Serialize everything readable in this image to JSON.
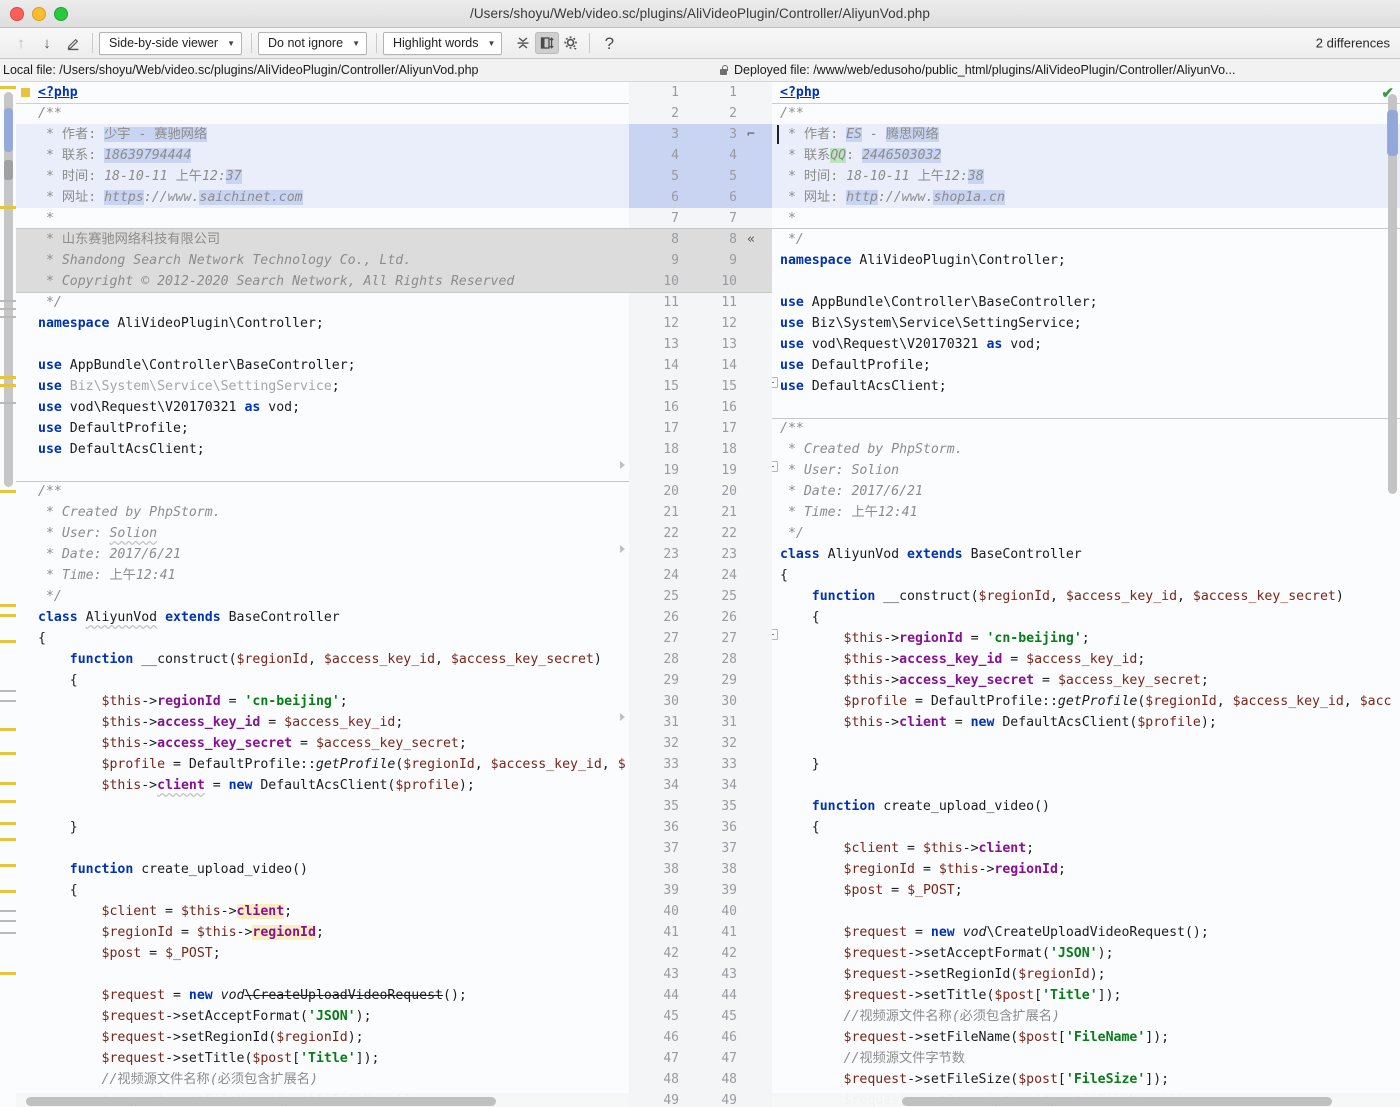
{
  "window": {
    "title": "/Users/shoyu/Web/video.sc/plugins/AliVideoPlugin/Controller/AliyunVod.php",
    "traffic_colors": {
      "close": "#ff5f57",
      "minimize": "#febc2e",
      "zoom": "#28c840"
    }
  },
  "toolbar": {
    "prev_diff_icon": "arrow-up-icon",
    "next_diff_icon": "arrow-down-icon",
    "edit_icon": "pencil-icon",
    "viewer_mode": "Side-by-side viewer",
    "ignore_policy": "Do not ignore",
    "highlight_mode": "Highlight words",
    "collapse_icon": "collapse-unchanged-icon",
    "sync_scroll_icon": "synchronize-scroll-icon",
    "settings_icon": "gear-icon",
    "help_icon": "help-icon",
    "differences_label": "2 differences"
  },
  "paths": {
    "local_label": "Local file: /Users/shoyu/Web/video.sc/plugins/AliVideoPlugin/Controller/AliyunVod.php",
    "deployed_label": "Deployed file: /www/web/edusoho/public_html/plugins/AliVideoPlugin/Controller/AliyunVo...",
    "lock_icon": "lock-icon",
    "ok_icon": "checkmark-icon"
  },
  "left_pane": {
    "lines": [
      "<?php",
      "/**",
      " * 作者: 少宇 - 赛驰网络",
      " * 联系: 18639794444",
      " * 时间: 18-10-11 上午12:37",
      " * 网址: https://www.saichinet.com",
      " *",
      " * 山东赛驰网络科技有限公司",
      " * Shandong Search Network Technology Co., Ltd.",
      " * Copyright © 2012-2020 Search Network, All Rights Reserved",
      " */",
      "namespace AliVideoPlugin\\Controller;",
      "",
      "use AppBundle\\Controller\\BaseController;",
      "use Biz\\System\\Service\\SettingService;",
      "use vod\\Request\\V20170321 as vod;",
      "use DefaultProfile;",
      "use DefaultAcsClient;",
      "",
      "/**",
      " * Created by PhpStorm.",
      " * User: Solion",
      " * Date: 2017/6/21",
      " * Time: 上午12:41",
      " */",
      "class AliyunVod extends BaseController",
      "{",
      "    function __construct($regionId, $access_key_id, $access_key_secret)",
      "    {",
      "        $this->regionId = 'cn-beijing';",
      "        $this->access_key_id = $access_key_id;",
      "        $this->access_key_secret = $access_key_secret;",
      "        $profile = DefaultProfile::getProfile($regionId, $access_key_id, $",
      "        $this->client = new DefaultAcsClient($profile);",
      "",
      "    }",
      "",
      "    function create_upload_video()",
      "    {",
      "        $client = $this->client;",
      "        $regionId = $this->regionId;",
      "        $post = $_POST;",
      "",
      "        $request = new vod\\CreateUploadVideoRequest();",
      "        $request->setAcceptFormat('JSON');",
      "        $request->setRegionId($regionId);",
      "        $request->setTitle($post['Title']);",
      "        //视频源文件名称(必须包含扩展名)"
    ]
  },
  "right_pane": {
    "line_numbers_a": [
      1,
      2,
      3,
      4,
      5,
      6,
      7,
      8,
      9,
      10,
      11,
      12,
      13,
      14,
      15,
      16,
      17,
      18,
      19,
      20,
      21,
      22,
      23,
      24,
      25,
      26,
      27,
      28,
      29,
      30,
      31,
      32,
      33,
      34,
      35,
      36,
      37,
      38,
      39,
      40,
      41,
      42,
      43,
      44,
      45,
      46,
      47,
      48,
      49
    ],
    "line_numbers_b": [
      1,
      2,
      3,
      4,
      5,
      6,
      7,
      8,
      9,
      10,
      11,
      12,
      13,
      14,
      15,
      16,
      17,
      18,
      19,
      20,
      21,
      22,
      23,
      24,
      25,
      26,
      27,
      28,
      29,
      30,
      31,
      32,
      33,
      34,
      35,
      36,
      37,
      38,
      39,
      40,
      41,
      42,
      43,
      44,
      45,
      46,
      47,
      48,
      49
    ],
    "gutter_glyph_3": "⌐",
    "gutter_glyph_8": "«",
    "lines": [
      "<?php",
      "/**",
      " * 作者: ES - 腾思网络",
      " * 联系QQ: 2446503032",
      " * 时间: 18-10-11 上午12:38",
      " * 网址: http://www.shop1a.cn",
      " *",
      " */",
      "namespace AliVideoPlugin\\Controller;",
      "",
      "use AppBundle\\Controller\\BaseController;",
      "use Biz\\System\\Service\\SettingService;",
      "use vod\\Request\\V20170321 as vod;",
      "use DefaultProfile;",
      "use DefaultAcsClient;",
      "",
      "/**",
      " * Created by PhpStorm.",
      " * User: Solion",
      " * Date: 2017/6/21",
      " * Time: 上午12:41",
      " */",
      "class AliyunVod extends BaseController",
      "{",
      "    function __construct($regionId, $access_key_id, $access_key_secret)",
      "    {",
      "        $this->regionId = 'cn-beijing';",
      "        $this->access_key_id = $access_key_id;",
      "        $this->access_key_secret = $access_key_secret;",
      "        $profile = DefaultProfile::getProfile($regionId, $access_key_id, $acc",
      "        $this->client = new DefaultAcsClient($profile);",
      "",
      "    }",
      "",
      "    function create_upload_video()",
      "    {",
      "        $client = $this->client;",
      "        $regionId = $this->regionId;",
      "        $post = $_POST;",
      "",
      "        $request = new vod\\CreateUploadVideoRequest();",
      "        $request->setAcceptFormat('JSON');",
      "        $request->setRegionId($regionId);",
      "        $request->setTitle($post['Title']);",
      "        //视频源文件名称(必须包含扩展名)",
      "        $request->setFileName($post['FileName']);",
      "        //视频源文件字节数",
      "        $request->setFileSize($post['FileSize']);",
      "        $request->setDescription($post['FileName']);"
    ]
  },
  "colors": {
    "modified_block": "#eaeefb",
    "modified_word": "#c9d4f2",
    "deleted_block": "#dcdcdc",
    "inserted_word": "#bee6be",
    "identifier_highlight": "#fbeec1",
    "keyword": "#0033b3",
    "string": "#067d17",
    "comment": "#8c8c8c",
    "property": "#871094",
    "variable": "#7a2518",
    "ok_check": "#3e9c3e",
    "php_marker": "#e8c33c"
  }
}
